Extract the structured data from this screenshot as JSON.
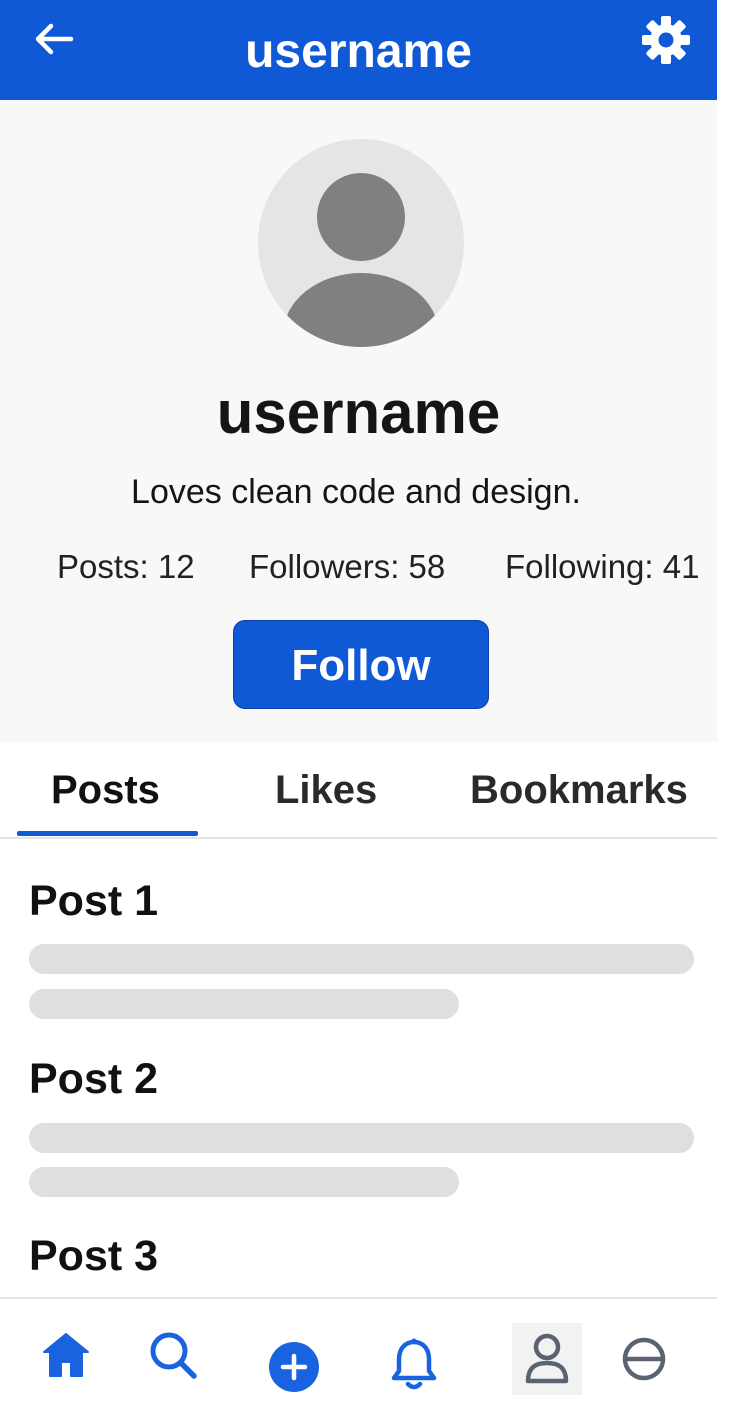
{
  "header": {
    "title": "username",
    "back_icon": "arrow-left-icon",
    "settings_icon": "gear-icon"
  },
  "profile": {
    "avatar_icon": "user-avatar-icon",
    "username": "username",
    "bio": "Loves clean code and design.",
    "stats": {
      "posts": "Posts: 12",
      "followers": "Followers: 58",
      "following": "Following: 41"
    },
    "follow_label": "Follow"
  },
  "tabs": [
    {
      "label": "Posts",
      "active": true
    },
    {
      "label": "Likes",
      "active": false
    },
    {
      "label": "Bookmarks",
      "active": false
    }
  ],
  "posts": [
    {
      "title": "Post 1"
    },
    {
      "title": "Post 2"
    },
    {
      "title": "Post 3"
    }
  ],
  "bottom_nav": [
    {
      "icon": "home-icon"
    },
    {
      "icon": "search-icon"
    },
    {
      "icon": "add-icon"
    },
    {
      "icon": "bell-icon"
    },
    {
      "icon": "profile-icon"
    },
    {
      "icon": "minus-circle-icon"
    }
  ],
  "colors": {
    "accent": "#0f59d6",
    "background": "#ffffff",
    "profile_background": "#f8f8f8",
    "placeholder": "#dfdfdf",
    "avatar_fill": "#808080"
  }
}
